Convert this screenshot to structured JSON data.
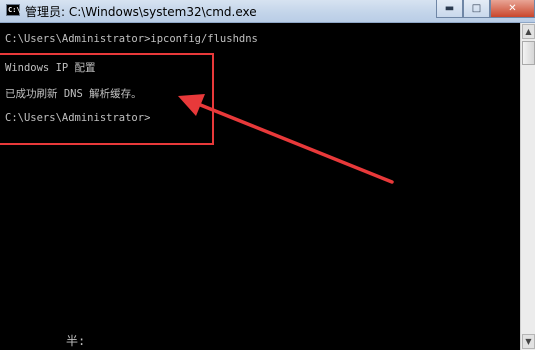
{
  "window": {
    "title": "管理员: C:\\Windows\\system32\\cmd.exe",
    "icon_name": "cmd-icon",
    "icon_text": "C:\\",
    "minimize_glyph": "▬",
    "maximize_glyph": "□",
    "close_glyph": "✕"
  },
  "console": {
    "lines": [
      "C:\\Users\\Administrator>ipconfig/flushdns",
      "Windows IP 配置",
      "已成功刷新 DNS 解析缓存。",
      "C:\\Users\\Administrator>"
    ]
  },
  "ime_status": "半:",
  "annotation": {
    "color": "#e8393a"
  }
}
